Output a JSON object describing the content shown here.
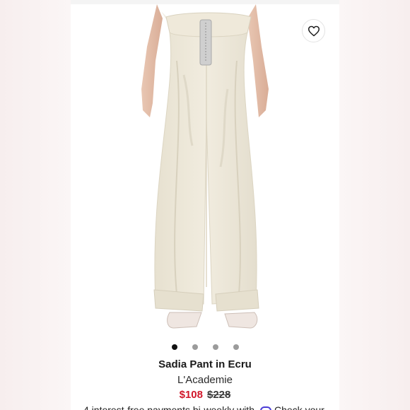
{
  "product": {
    "title": "Sadia Pant in Ecru",
    "brand": "L'Academie",
    "sale_price": "$108",
    "original_price": "$228",
    "installments_text": "4 interest-free payments bi-weekly with",
    "installments_link": "Check your"
  },
  "gallery": {
    "slide_count": 4,
    "active_index": 0
  },
  "icons": {
    "wishlist": "heart-icon",
    "payment_provider": "pay-provider-logo"
  },
  "colors": {
    "sale_price": "#d1182b",
    "garment": "#ece7d8",
    "active_dot": "#111111",
    "inactive_dot": "#9b9b9b"
  }
}
